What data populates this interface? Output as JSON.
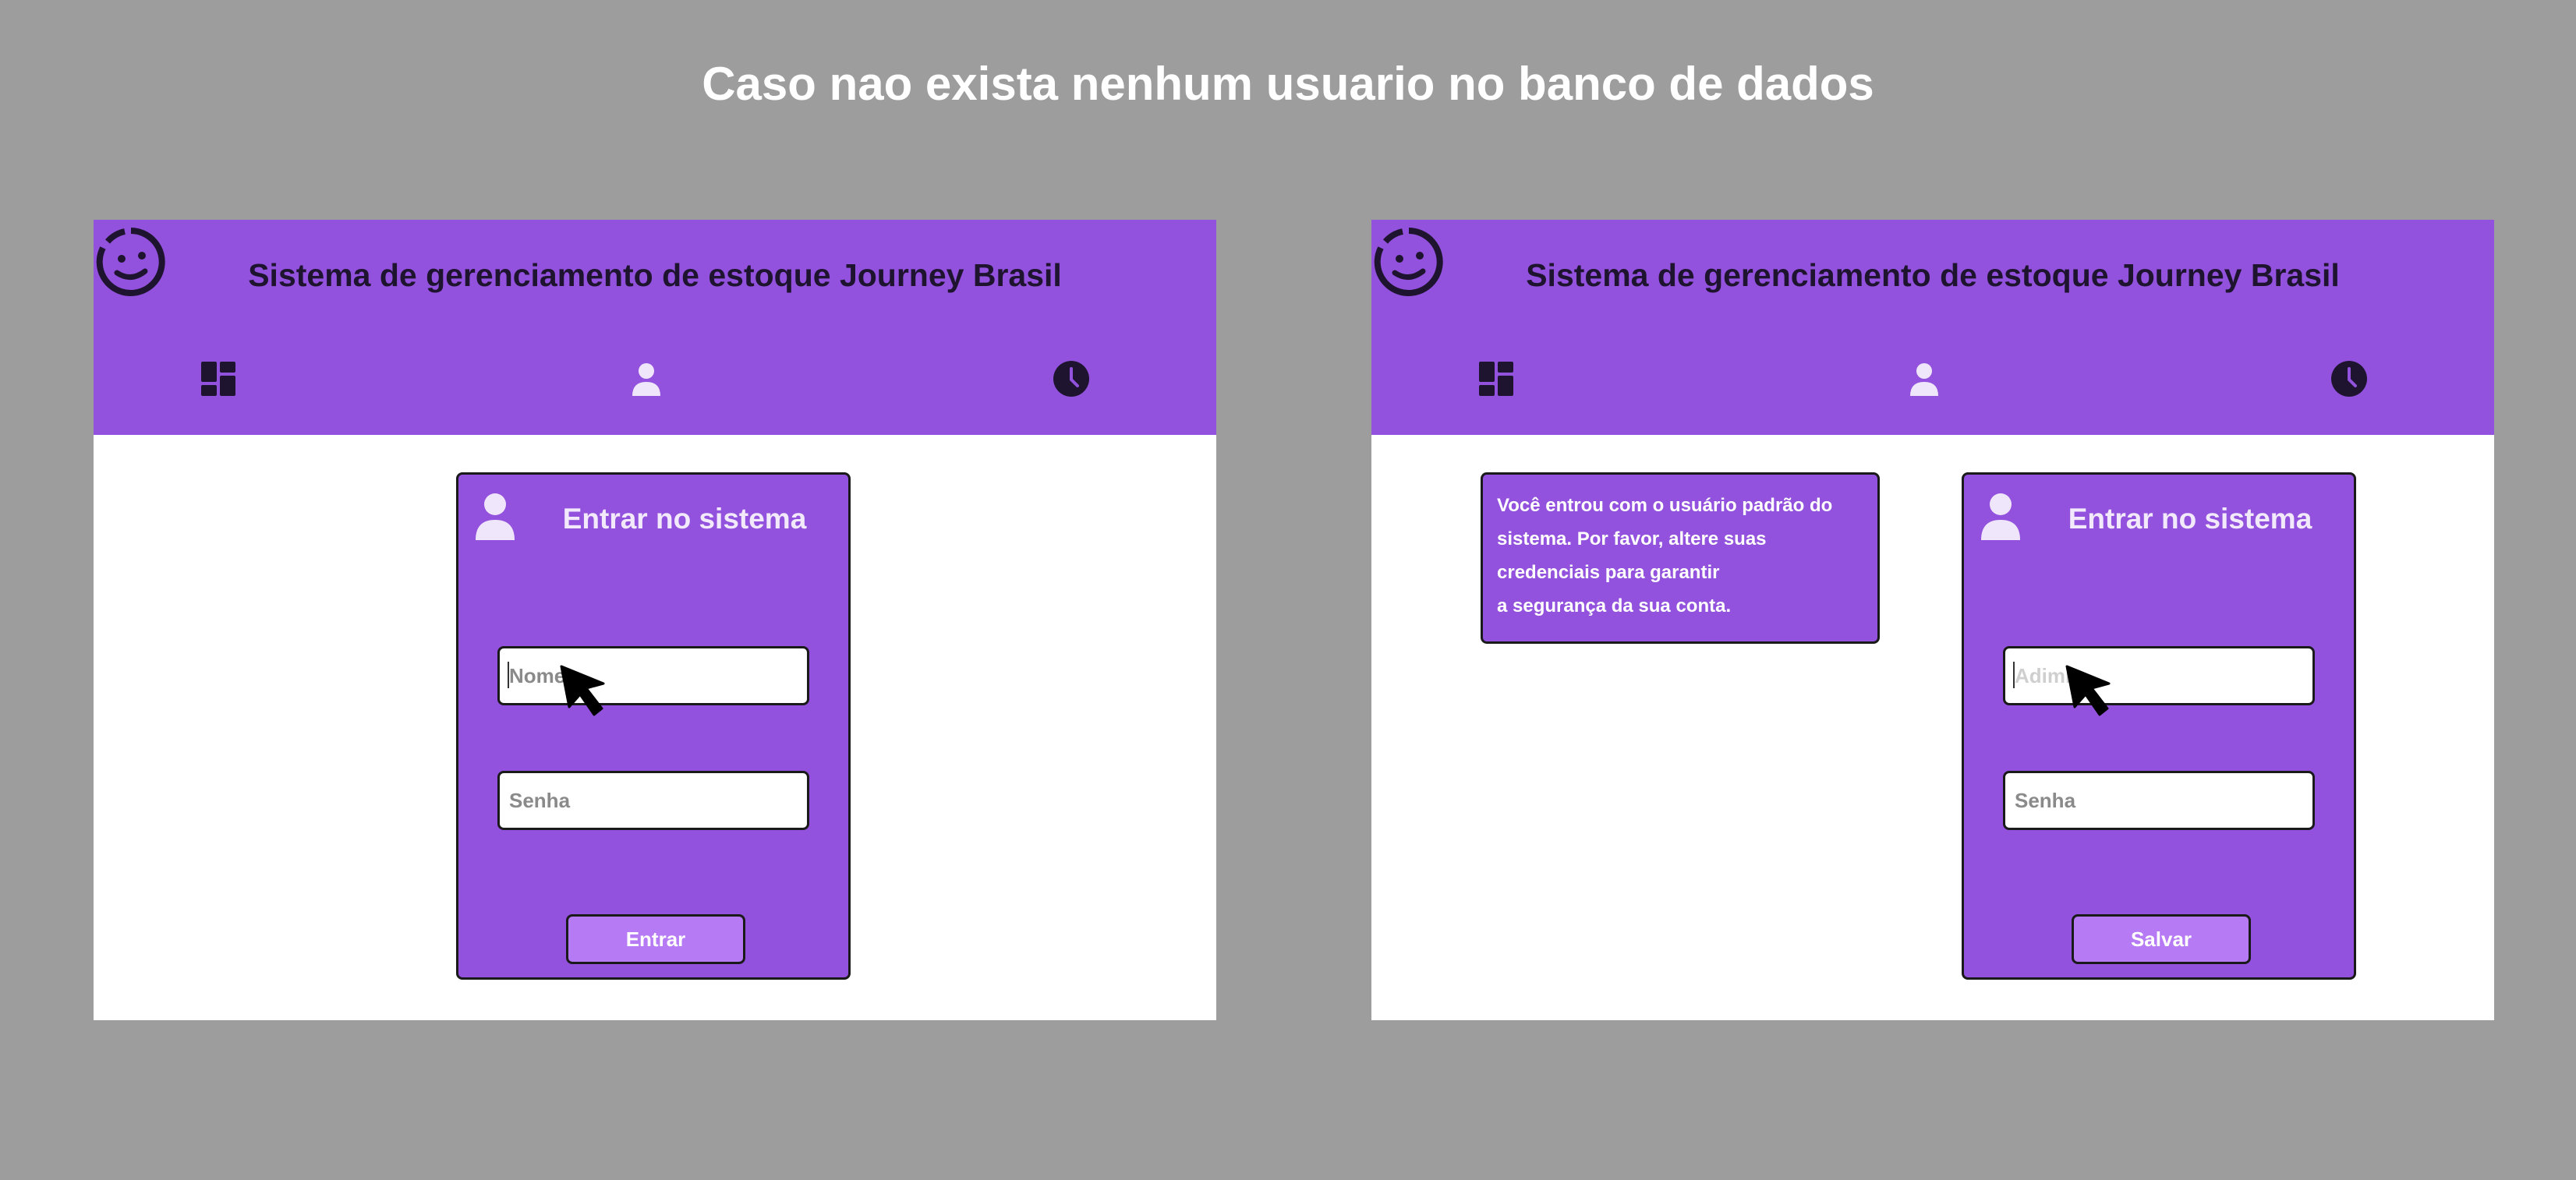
{
  "page_title": "Caso nao exista nenhum usuario no banco de dados",
  "colors": {
    "background": "#9d9d9d",
    "brand_purple": "#9352dd",
    "button_purple": "#b67af5",
    "dark": "#1e1430"
  },
  "screens": [
    {
      "header": {
        "title": "Sistema de gerenciamento de estoque Journey Brasil",
        "logo_icon": "smiley-logo-icon",
        "nav": [
          "dashboard-icon",
          "user-icon",
          "clock-icon"
        ]
      },
      "login": {
        "title": "Entrar no sistema",
        "username_placeholder": "Nome",
        "password_placeholder": "Senha",
        "submit_label": "Entrar"
      }
    },
    {
      "header": {
        "title": "Sistema de gerenciamento de estoque Journey Brasil",
        "logo_icon": "smiley-logo-icon",
        "nav": [
          "dashboard-icon",
          "user-icon",
          "clock-icon"
        ]
      },
      "notice": "Você entrou com o usuário padrão do\n sistema. Por favor, altere suas\ncredenciais para garantir\n a segurança da sua conta.",
      "login": {
        "title": "Entrar no sistema",
        "username_placeholder": "Adimin",
        "password_placeholder": "Senha",
        "submit_label": "Salvar"
      }
    }
  ]
}
